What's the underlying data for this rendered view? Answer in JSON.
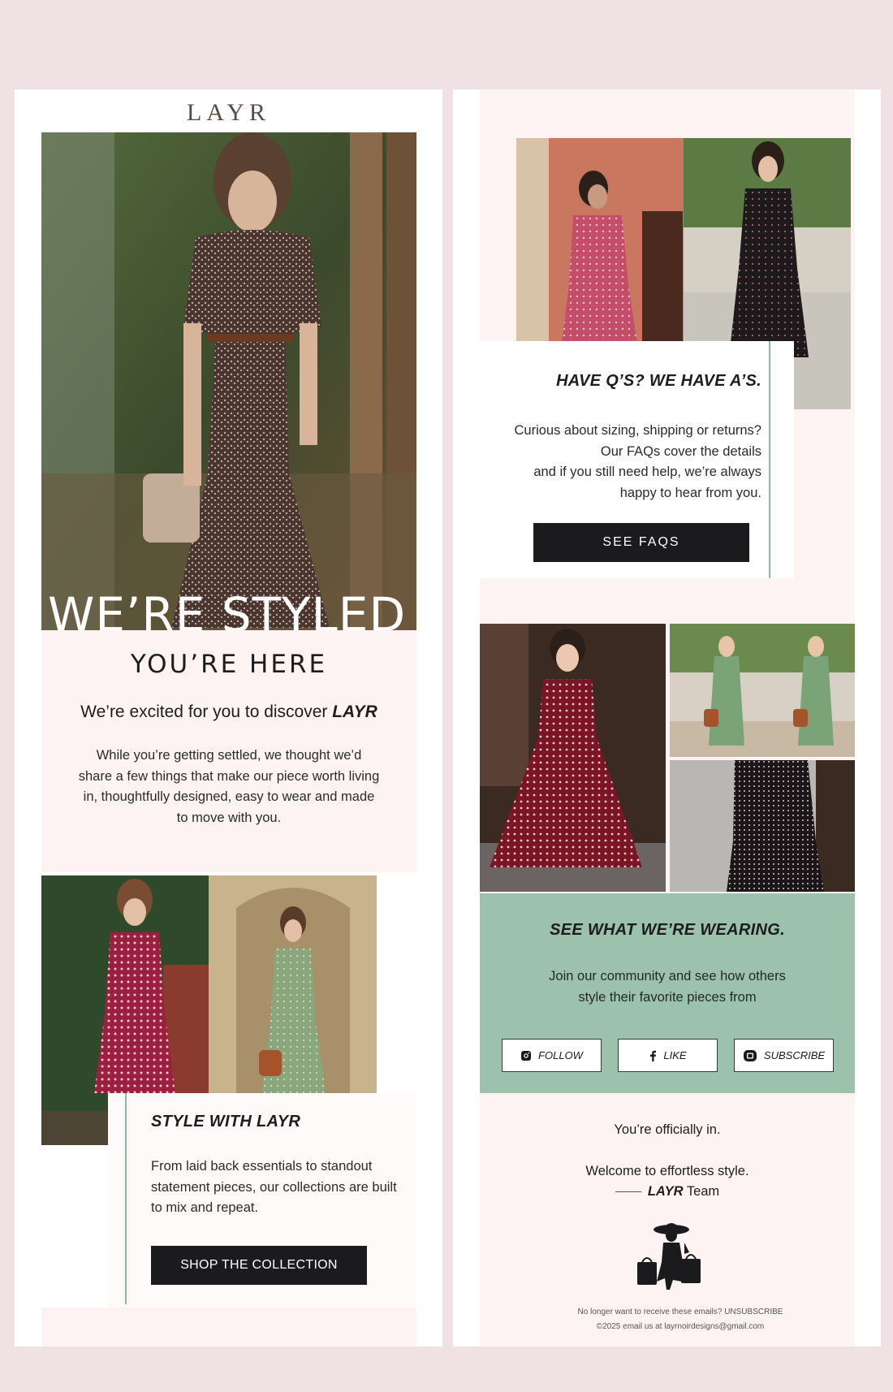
{
  "colors": {
    "background": "#efe1e4",
    "panel": "#ffffff",
    "blush": "#fdf3f3",
    "sage_green": "#9cc1ad",
    "accent_line": "#8ab9a8",
    "button_dark": "#1b1b1d"
  },
  "left": {
    "logo": "LAYR",
    "hero_overlay": "WE’RE STYLED",
    "heading": "YOU’RE HERE",
    "subhead_prefix": "We’re excited for you to discover ",
    "subhead_brand": "LAYR",
    "intro_lines": [
      "While you’re getting settled, we thought we’d",
      "share a few things that make our piece worth living",
      "in, thoughtfully designed, easy to wear and made",
      "to move with you."
    ],
    "style_title": "STYLE WITH LAYR",
    "style_lines": [
      "From laid back essentials to standout",
      "statement pieces, our collections are built",
      "to mix and repeat."
    ],
    "shop_button": "SHOP THE COLLECTION"
  },
  "right": {
    "faq_title": "HAVE Q’S?  WE HAVE A’S.",
    "faq_lines": [
      "Curious about sizing, shipping or returns?",
      "Our FAQs cover the details",
      "and if you still need help, we’re always",
      "happy to hear from you."
    ],
    "faq_button": "SEE FAQS",
    "wearing_title": "SEE WHAT WE’RE WEARING.",
    "wearing_lines": [
      "Join our community and see how others",
      "style their favorite pieces from"
    ],
    "social": [
      {
        "label": "FOLLOW",
        "icon": "instagram-icon"
      },
      {
        "label": "LIKE",
        "icon": "facebook-icon"
      },
      {
        "label": "SUBSCRIBE",
        "icon": "youtube-icon"
      }
    ],
    "closing_1": "You’re officially in.",
    "closing_2": "Welcome to effortless style.",
    "signature_brand": "LAYR",
    "signature_team": " Team",
    "footer_unsub": "No longer want to receive these emails? UNSUBSCRIBE",
    "footer_copy": "©2025 email us at layrnoirdesigns@gmail.com"
  }
}
